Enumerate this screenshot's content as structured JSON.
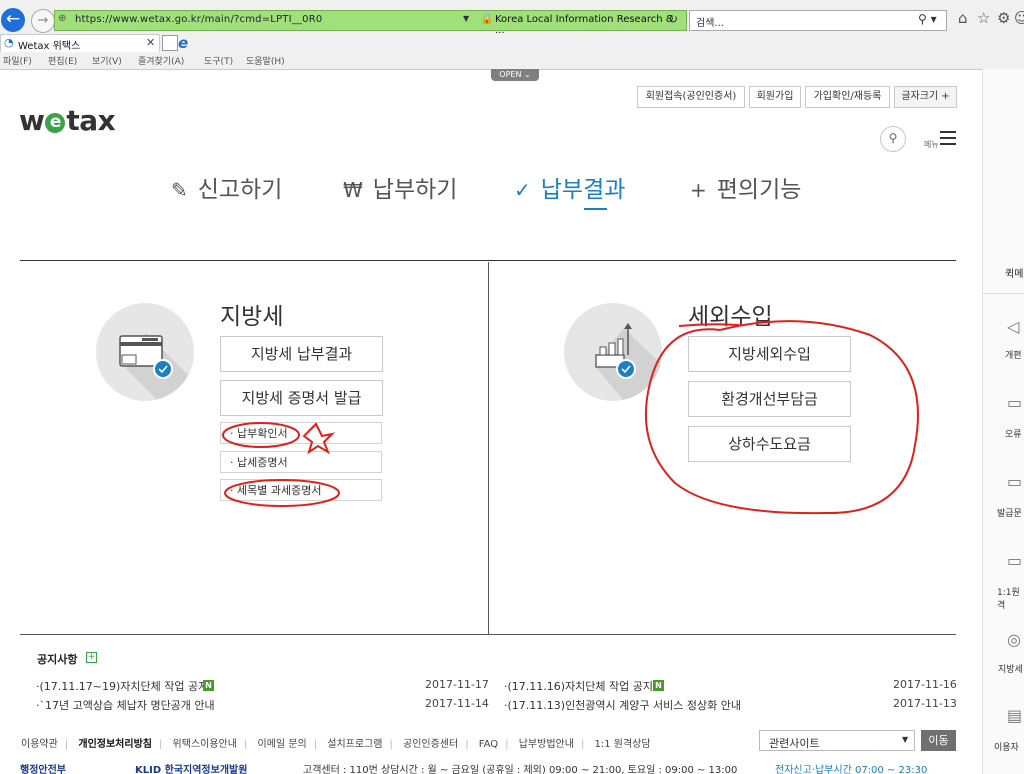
{
  "browser": {
    "url": "https://www.wetax.go.kr/main/?cmd=LPTI__0R0",
    "site_name": "Korea Local Information Research & ...",
    "search_placeholder": "검색...",
    "tab_title": "Wetax 위택스",
    "menu": [
      "파일(F)",
      "편집(E)",
      "보기(V)",
      "즐겨찾기(A)",
      "도구(T)",
      "도움말(H)"
    ]
  },
  "header": {
    "open_label": "OPEN ⌄",
    "logo_pre": "w",
    "logo_e": "e",
    "logo_post": "tax",
    "top_links": [
      "회원접속(공인인증서)",
      "회원가입",
      "가입확인/재등록",
      "글자크기 +"
    ],
    "menu_label": "메뉴"
  },
  "main_tabs": [
    {
      "icon": "✎",
      "label": "신고하기"
    },
    {
      "icon": "₩",
      "label": "납부하기"
    },
    {
      "icon": "✓",
      "label": "납부결과"
    },
    {
      "icon": "+",
      "label": "편의기능"
    }
  ],
  "local_tax": {
    "title": "지방세",
    "buttons": [
      "지방세 납부결과",
      "지방세 증명서 발급"
    ],
    "sub_items": [
      "· 납부확인서",
      "· 납세증명서",
      "· 세목별 과세증명서"
    ]
  },
  "non_tax": {
    "title": "세외수입",
    "buttons": [
      "지방세외수입",
      "환경개선부담금",
      "상하수도요금"
    ]
  },
  "notice": {
    "title": "공지사항",
    "plus": "+",
    "items": [
      {
        "text": "·(17.11.17~19)자치단체 작업 공지",
        "new": "N",
        "date": "2017-11-17"
      },
      {
        "text": "·(17.11.16)자치단체 작업 공지",
        "new": "N",
        "date": "2017-11-16"
      },
      {
        "text": "·`17년 고액상습 체납자 명단공개 안내",
        "new": "",
        "date": "2017-11-14"
      },
      {
        "text": "·(17.11.13)인천광역시 계양구 서비스 정상화 안내",
        "new": "",
        "date": "2017-11-13"
      }
    ]
  },
  "footer": {
    "links": [
      "이용약관",
      "개인정보처리방침",
      "위택스이용안내",
      "이메일 문의",
      "설치프로그램",
      "공인인증센터",
      "FAQ",
      "납부방법안내",
      "1:1 원격상담"
    ],
    "related_site": "관련사이트",
    "go_label": "이동",
    "bottom_org1": "행정안전부",
    "bottom_org2": "KLID 한국지역정보개발원",
    "bottom_info": "고객센터 : 110번  상담시간 : 월 ~ 금요일 (공휴일 : 제외) 09:00 ~ 21:00, 토요일 : 09:00 ~ 13:00",
    "bottom_hours": "전자신고·납부시간 07:00 ~ 23:30"
  },
  "quick_panel": {
    "title": "퀵메",
    "items": [
      "개편",
      "오류",
      "발급문",
      "1:1원격",
      "지방세",
      "이용자"
    ]
  },
  "colors": {
    "accent": "#1b7fc4",
    "brand_green": "#3aa34a",
    "address_green": "#9fe07a",
    "annotation_red": "#e0201b"
  }
}
